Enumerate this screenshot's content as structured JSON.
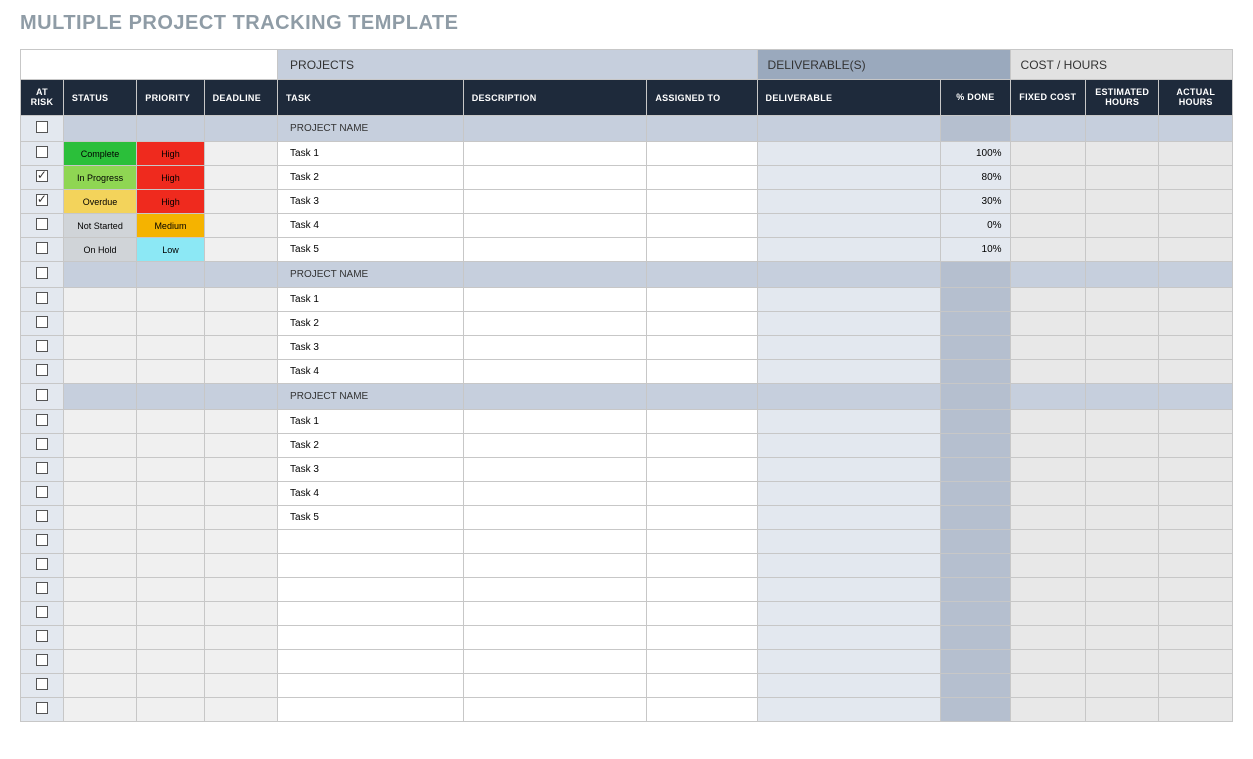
{
  "title": "MULTIPLE PROJECT TRACKING TEMPLATE",
  "groupHeaders": {
    "projects": "PROJECTS",
    "deliverables": "DELIVERABLE(S)",
    "cost": "COST / HOURS"
  },
  "columns": {
    "atRisk": "AT RISK",
    "status": "STATUS",
    "priority": "PRIORITY",
    "deadline": "DEADLINE",
    "task": "TASK",
    "description": "DESCRIPTION",
    "assignedTo": "ASSIGNED TO",
    "deliverable": "DELIVERABLE",
    "pctDone": "% DONE",
    "fixedCost": "FIXED COST",
    "estHours": "ESTIMATED HOURS",
    "actHours": "ACTUAL HOURS"
  },
  "projectLabel": "PROJECT NAME",
  "statusLabels": {
    "complete": "Complete",
    "inProgress": "In Progress",
    "overdue": "Overdue",
    "notStarted": "Not Started",
    "onHold": "On Hold"
  },
  "priorityLabels": {
    "high": "High",
    "medium": "Medium",
    "low": "Low"
  },
  "groups": [
    {
      "tasks": [
        {
          "atRisk": false,
          "status": "complete",
          "priority": "high",
          "task": "Task 1",
          "pctDone": "100%"
        },
        {
          "atRisk": true,
          "status": "inProgress",
          "priority": "high",
          "task": "Task 2",
          "pctDone": "80%"
        },
        {
          "atRisk": true,
          "status": "overdue",
          "priority": "high",
          "task": "Task 3",
          "pctDone": "30%"
        },
        {
          "atRisk": false,
          "status": "notStarted",
          "priority": "medium",
          "task": "Task 4",
          "pctDone": "0%"
        },
        {
          "atRisk": false,
          "status": "onHold",
          "priority": "low",
          "task": "Task 5",
          "pctDone": "10%"
        }
      ]
    },
    {
      "tasks": [
        {
          "atRisk": false,
          "task": "Task 1"
        },
        {
          "atRisk": false,
          "task": "Task 2"
        },
        {
          "atRisk": false,
          "task": "Task 3"
        },
        {
          "atRisk": false,
          "task": "Task 4"
        }
      ]
    },
    {
      "tasks": [
        {
          "atRisk": false,
          "task": "Task 1"
        },
        {
          "atRisk": false,
          "task": "Task 2"
        },
        {
          "atRisk": false,
          "task": "Task 3"
        },
        {
          "atRisk": false,
          "task": "Task 4"
        },
        {
          "atRisk": false,
          "task": "Task 5"
        }
      ]
    }
  ],
  "trailingEmptyRows": 8
}
